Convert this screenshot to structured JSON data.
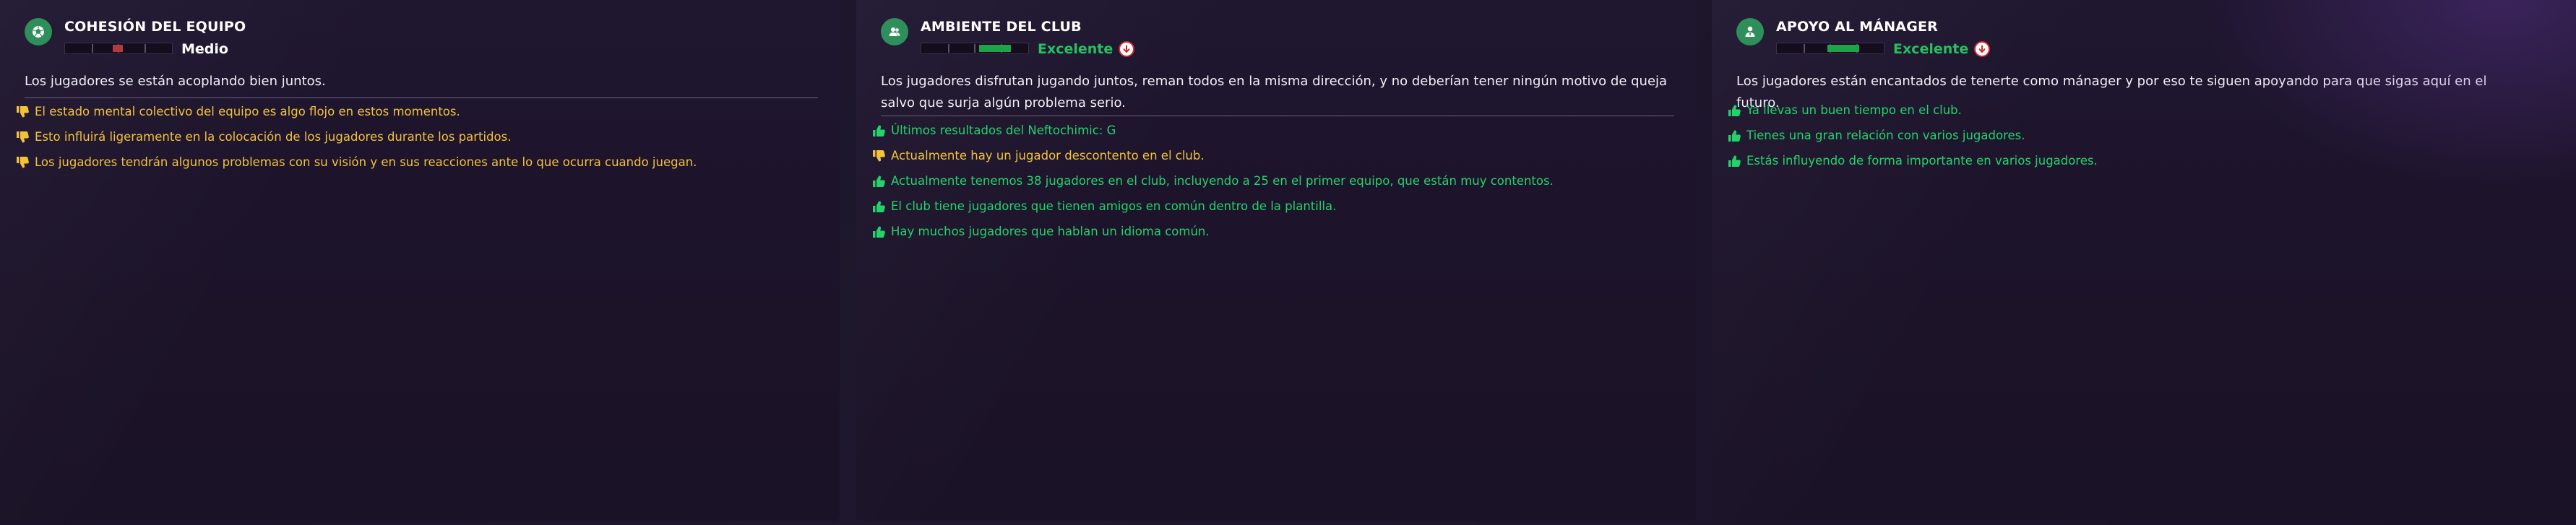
{
  "colors": {
    "positive": "#22d36a",
    "negative": "#f2c23a",
    "icon_bg": "#2f8f5a",
    "meter_good": "#1fa34a",
    "meter_medium": "#b23a3a",
    "trend_down": "#d12a2a"
  },
  "panels": [
    {
      "title": "COHESIÓN DEL EQUIPO",
      "icon": "football-icon",
      "rating": "Medio",
      "rating_color": "#ffffff",
      "meter_level": 0.5,
      "trend": null,
      "summary": "Los jugadores se están acoplando bien juntos.",
      "reasons": [
        {
          "type": "negative",
          "text": "El estado mental colectivo del equipo es algo flojo en estos momentos."
        },
        {
          "type": "negative",
          "text": "Esto influirá ligeramente en la colocación de los jugadores durante los partidos."
        },
        {
          "type": "negative",
          "text": "Los jugadores tendrán algunos problemas con su visión y en sus reacciones ante lo que ocurra cuando juegan."
        }
      ]
    },
    {
      "title": "AMBIENTE DEL CLUB",
      "icon": "people-icon",
      "rating": "Excelente",
      "rating_color": "#22c35e",
      "meter_level": 0.85,
      "trend": "down",
      "summary": "Los jugadores disfrutan jugando juntos, reman todos en la misma dirección, y no deberían tener ningún motivo de queja salvo que surja algún problema serio.",
      "reasons": [
        {
          "type": "positive",
          "text": "Últimos resultados del Neftochimic: G"
        },
        {
          "type": "negative",
          "text": "Actualmente hay un jugador descontento en el club."
        },
        {
          "type": "positive",
          "text": "Actualmente tenemos 38 jugadores en el club, incluyendo a 25 en el primer equipo, que están muy contentos."
        },
        {
          "type": "positive",
          "text": "El club tiene jugadores que tienen amigos en común dentro de la plantilla."
        },
        {
          "type": "positive",
          "text": "Hay muchos jugadores que hablan un idioma común."
        }
      ]
    },
    {
      "title": "APOYO AL MÁNAGER",
      "icon": "manager-icon",
      "rating": "Excelente",
      "rating_color": "#22c35e",
      "meter_level": 0.78,
      "trend": "down",
      "summary": "Los jugadores están encantados de tenerte como mánager y por eso te siguen apoyando para que sigas aquí en el futuro.",
      "reasons": [
        {
          "type": "positive",
          "text": "Ya llevas un buen tiempo en el club."
        },
        {
          "type": "positive",
          "text": "Tienes una gran relación con varios jugadores."
        },
        {
          "type": "positive",
          "text": "Estás influyendo de forma importante en varios jugadores."
        }
      ]
    }
  ]
}
